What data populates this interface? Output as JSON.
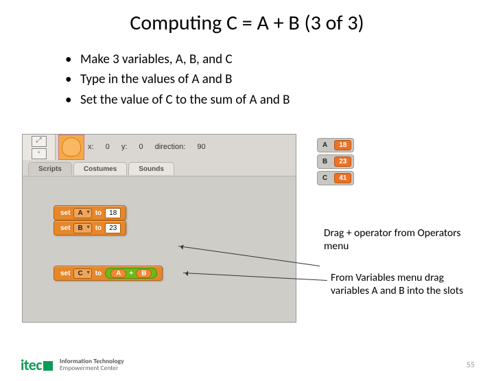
{
  "title": "Computing C = A + B (3 of 3)",
  "bullets": [
    "Make 3 variables, A, B, and C",
    "Type in the values of A and B",
    "Set the value of C to the sum of A and B"
  ],
  "sprite_info": {
    "x_label": "x:",
    "x": "0",
    "y_label": "y:",
    "y": "0",
    "dir_label": "direction:",
    "dir": "90"
  },
  "tabs": {
    "scripts": "Scripts",
    "costumes": "Costumes",
    "sounds": "Sounds"
  },
  "blocks": {
    "set_label": "set",
    "to_label": "to",
    "a": {
      "var": "A",
      "val": "18"
    },
    "b": {
      "var": "B",
      "val": "23"
    },
    "c": {
      "var": "C",
      "plus": "+",
      "operand_a": "A",
      "operand_b": "B"
    }
  },
  "monitors": {
    "a": {
      "name": "A",
      "val": "18"
    },
    "b": {
      "name": "B",
      "val": "23"
    },
    "c": {
      "name": "C",
      "val": "41"
    }
  },
  "notes": {
    "n1": "Drag + operator from Operators menu",
    "n2": "From Variables menu drag variables A and B into the slots"
  },
  "footer": {
    "logo": "itec",
    "line1": "Information Technology",
    "line2": "Empowerment Center"
  },
  "page": "55"
}
